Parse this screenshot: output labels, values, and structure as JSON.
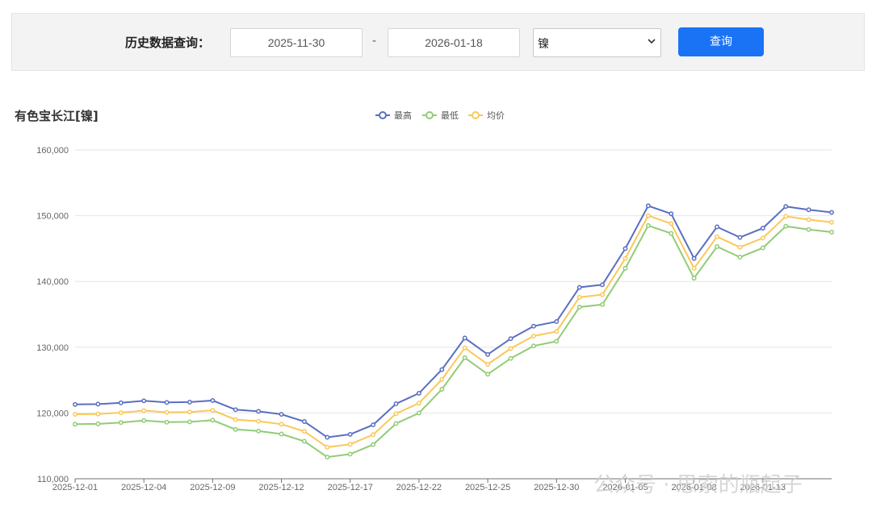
{
  "query": {
    "label": "历史数据查询：",
    "start_date": "2025-11-30",
    "separator": "-",
    "end_date": "2026-01-18",
    "metal_selected": "镍",
    "button_label": "查询"
  },
  "chart_title": "有色宝长江[镍]",
  "watermark": "公众号 · 思索的瓶起子",
  "colors": {
    "high": "#5a6fc0",
    "low": "#91cc75",
    "avg": "#fac858",
    "button": "#1a73f5"
  },
  "chart_data": {
    "type": "line",
    "title": "有色宝长江[镍]",
    "xlabel": "",
    "ylabel": "",
    "ylim": [
      110000,
      160000
    ],
    "y_ticks": [
      "110,000",
      "120,000",
      "130,000",
      "140,000",
      "150,000",
      "160,000"
    ],
    "x_tick_labels": [
      "2025-12-01",
      "2025-12-04",
      "2025-12-09",
      "2025-12-12",
      "2025-12-17",
      "2025-12-22",
      "2025-12-25",
      "2025-12-30",
      "2026-01-05",
      "2026-01-08",
      "2026-01-13"
    ],
    "x_tick_every": 3,
    "grid": true,
    "legend_position": "top-center",
    "x": [
      "2025-12-01",
      "2025-12-02",
      "2025-12-03",
      "2025-12-04",
      "2025-12-05",
      "2025-12-08",
      "2025-12-09",
      "2025-12-10",
      "2025-12-11",
      "2025-12-12",
      "2025-12-15",
      "2025-12-16",
      "2025-12-17",
      "2025-12-18",
      "2025-12-19",
      "2025-12-22",
      "2025-12-23",
      "2025-12-24",
      "2025-12-25",
      "2025-12-26",
      "2025-12-29",
      "2025-12-30",
      "2025-12-31",
      "2026-01-02",
      "2026-01-05",
      "2026-01-06",
      "2026-01-07",
      "2026-01-08",
      "2026-01-09",
      "2026-01-12",
      "2026-01-13",
      "2026-01-14",
      "2026-01-15",
      "2026-01-16"
    ],
    "series": [
      {
        "name": "最高",
        "key": "high",
        "values": [
          121300,
          121350,
          121550,
          121850,
          121600,
          121650,
          121900,
          120500,
          120250,
          119800,
          118700,
          116300,
          116750,
          118200,
          121400,
          123000,
          126600,
          131400,
          128900,
          131300,
          133200,
          133900,
          139100,
          139500,
          145000,
          151500,
          150300,
          143500,
          148300,
          146700,
          148100,
          151400,
          150900,
          150500
        ]
      },
      {
        "name": "最低",
        "key": "low",
        "values": [
          118300,
          118350,
          118550,
          118850,
          118600,
          118650,
          118900,
          117500,
          117250,
          116800,
          115700,
          113300,
          113750,
          115200,
          118400,
          120000,
          123600,
          128400,
          125900,
          128300,
          130200,
          130900,
          136100,
          136500,
          142000,
          148500,
          147300,
          140500,
          145300,
          143700,
          145100,
          148400,
          147900,
          147500
        ]
      },
      {
        "name": "均价",
        "key": "avg",
        "values": [
          119800,
          119850,
          120050,
          120350,
          120100,
          120150,
          120400,
          119000,
          118750,
          118300,
          117200,
          114800,
          115250,
          116700,
          119900,
          121500,
          125100,
          129900,
          127400,
          129800,
          131700,
          132400,
          137600,
          138000,
          143500,
          150000,
          148800,
          142000,
          146800,
          145200,
          146600,
          149900,
          149400,
          149000
        ]
      }
    ]
  }
}
